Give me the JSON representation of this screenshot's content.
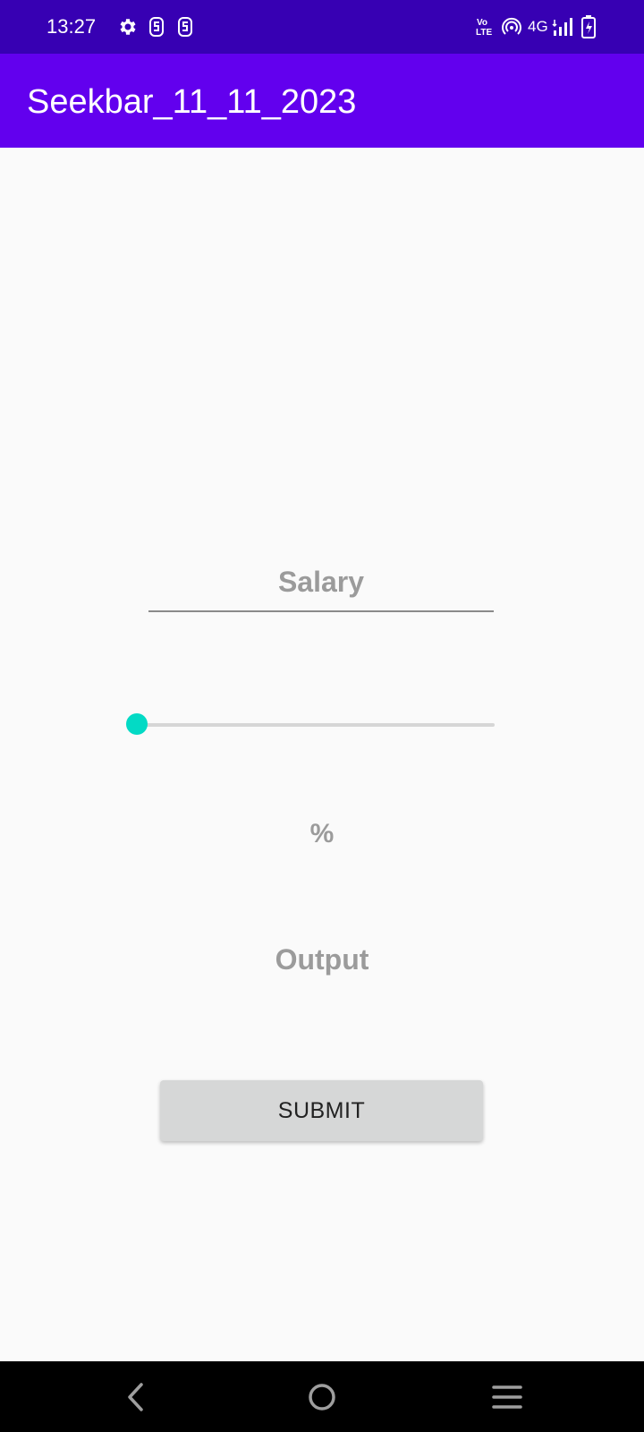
{
  "status_bar": {
    "time": "13:27",
    "network_label": "4G",
    "icons": [
      "gear-icon",
      "sim-icon",
      "sim-icon",
      "volte-icon",
      "hotspot-icon",
      "signal-icon",
      "battery-charging-icon"
    ]
  },
  "app_bar": {
    "title": "Seekbar_11_11_2023",
    "color": "#6200ee"
  },
  "form": {
    "salary_placeholder": "Salary",
    "salary_value": "",
    "seekbar_value": 0,
    "percent_label": "%",
    "output_label": "Output",
    "submit_label": "SUBMIT"
  },
  "colors": {
    "status_bar": "#3700b3",
    "accent": "#03dac5",
    "background": "#fafafa"
  },
  "nav_bar": {
    "buttons": [
      "back-icon",
      "home-icon",
      "recents-icon"
    ]
  }
}
